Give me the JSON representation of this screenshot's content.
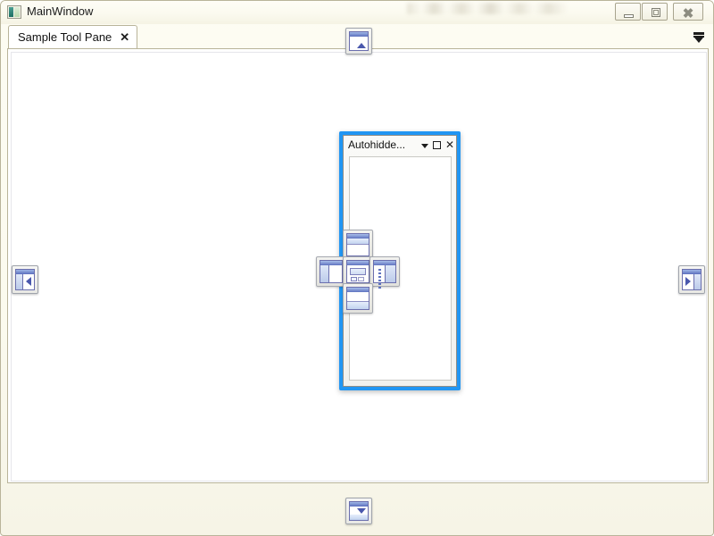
{
  "window": {
    "title": "MainWindow",
    "icon": "window-icon",
    "blurred_text": "",
    "controls": {
      "minimize": "Minimize",
      "maximize": "Maximize",
      "close": "Close"
    }
  },
  "tabstrip": {
    "tabs": [
      {
        "label": "Sample Tool Pane",
        "close": "✕",
        "active": true
      }
    ],
    "overflow_label": "chevron-down-icon"
  },
  "floating_window": {
    "title": "Autohidde...",
    "menu_icon": "chevron-down-icon",
    "maximize_icon": "maximize-icon",
    "close_icon": "✕",
    "accent_color": "#2196f3",
    "content": ""
  },
  "dock_guides": {
    "center": {
      "name": "dock-center",
      "tooltip": "Dock as tabbed document"
    },
    "top": {
      "name": "dock-top",
      "tooltip": "Dock top"
    },
    "bottom": {
      "name": "dock-bottom",
      "tooltip": "Dock bottom"
    },
    "left": {
      "name": "dock-left",
      "tooltip": "Dock left"
    },
    "right": {
      "name": "dock-right",
      "tooltip": "Dock right"
    },
    "edge_top": {
      "name": "edge-guide-top",
      "tooltip": "Dock to top edge"
    },
    "edge_bottom": {
      "name": "edge-guide-bottom",
      "tooltip": "Dock to bottom edge"
    },
    "edge_left": {
      "name": "edge-guide-left",
      "tooltip": "Dock to left edge"
    },
    "edge_right": {
      "name": "edge-guide-right",
      "tooltip": "Dock to right edge"
    }
  },
  "colors": {
    "accent_blue": "#2196f3",
    "chrome_cream": "#fbfaef",
    "chrome_border": "#b9b49a",
    "guide_border": "#6b6fae",
    "guide_title": "#5f73c0"
  }
}
